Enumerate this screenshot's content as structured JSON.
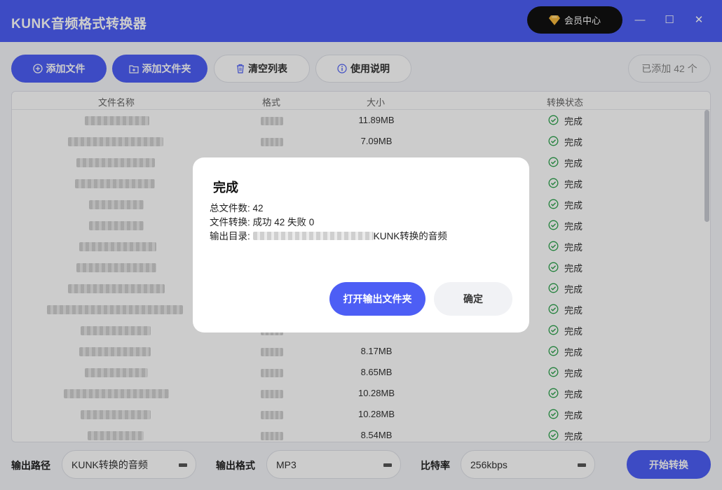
{
  "app": {
    "title": "KUNK音频格式转换器"
  },
  "header": {
    "member_label": "会员中心",
    "minimize": "—",
    "maximize": "☐",
    "close": "✕"
  },
  "toolbar": {
    "add_file": "添加文件",
    "add_folder": "添加文件夹",
    "clear_list": "清空列表",
    "help": "使用说明",
    "count_prefix": "已添加",
    "count": "42",
    "count_suffix": "个"
  },
  "table": {
    "columns": {
      "name": "文件名称",
      "format": "格式",
      "size": "大小",
      "status": "转换状态"
    },
    "rows": [
      {
        "size": "11.89MB",
        "status": "完成"
      },
      {
        "size": "7.09MB",
        "status": "完成"
      },
      {
        "size": "",
        "status": "完成"
      },
      {
        "size": "",
        "status": "完成"
      },
      {
        "size": "",
        "status": "完成"
      },
      {
        "size": "",
        "status": "完成"
      },
      {
        "size": "",
        "status": "完成"
      },
      {
        "size": "",
        "status": "完成"
      },
      {
        "size": "",
        "status": "完成"
      },
      {
        "size": "",
        "status": "完成"
      },
      {
        "size": "",
        "status": "完成"
      },
      {
        "size": "8.17MB",
        "status": "完成"
      },
      {
        "size": "8.65MB",
        "status": "完成"
      },
      {
        "size": "10.28MB",
        "status": "完成"
      },
      {
        "size": "10.28MB",
        "status": "完成"
      },
      {
        "size": "8.54MB",
        "status": "完成"
      }
    ]
  },
  "bottom": {
    "output_path_label": "输出路径",
    "output_path_value": "KUNK转换的音频",
    "output_format_label": "输出格式",
    "output_format_value": "MP3",
    "bitrate_label": "比特率",
    "bitrate_value": "256kbps",
    "start_label": "开始转换"
  },
  "dialog": {
    "title": "完成",
    "total_label": "总文件数: 42",
    "convert_label": "文件转换: 成功 42 失败 0",
    "output_dir_label": "输出目录:",
    "output_dir_suffix": "KUNK转换的音频",
    "open_folder": "打开输出文件夹",
    "confirm": "确定"
  },
  "colors": {
    "accent": "#4d5ef5",
    "success": "#2aa14a",
    "member_bg": "#111111"
  }
}
